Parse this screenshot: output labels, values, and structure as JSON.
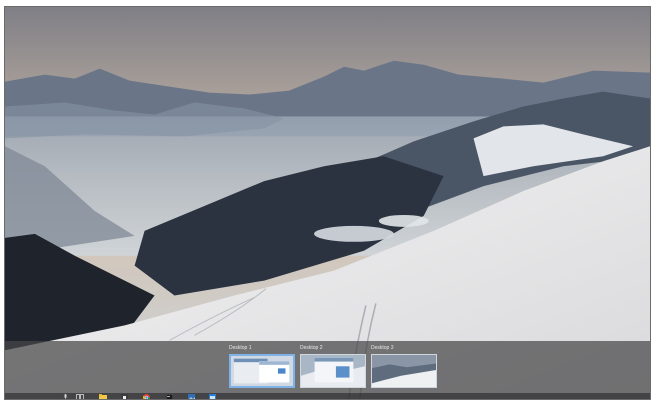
{
  "desktops": [
    {
      "label": "Desktop 1",
      "active": true
    },
    {
      "label": "Desktop 2",
      "active": false
    },
    {
      "label": "Desktop 3",
      "active": false
    }
  ],
  "taskbar_icons": [
    "microphone-icon",
    "task-view-icon",
    "file-explorer-icon",
    "store-icon",
    "chrome-icon",
    "terminal-icon",
    "photos-icon",
    "window-app-icon"
  ],
  "colors": {
    "strip_background": "#464648",
    "active_desktop_border": "#7fb2e6",
    "taskbar_background": "#28282a",
    "sky_top": "#7f7f86",
    "snow": "#e9e9ea"
  }
}
